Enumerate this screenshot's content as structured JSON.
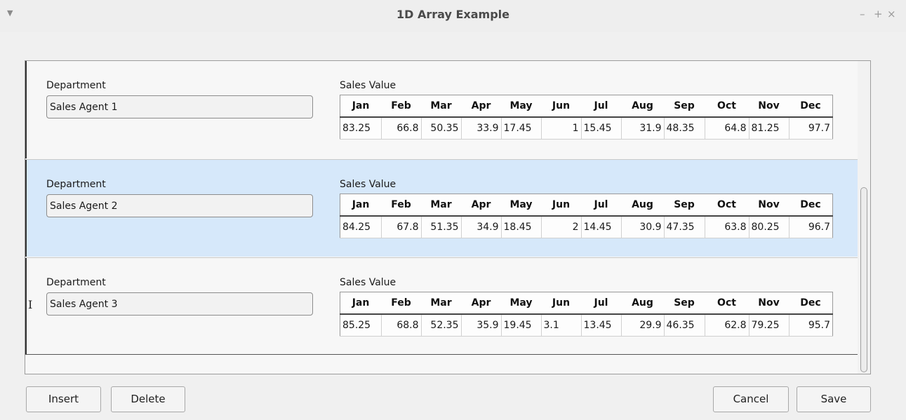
{
  "window": {
    "title": "1D Array Example",
    "menu_icon": "triangle-down-icon",
    "minimize_icon": "minimize-icon",
    "maximize_icon": "maximize-icon",
    "close_icon": "close-icon"
  },
  "list": {
    "selected_index": 1,
    "rows": [
      {
        "department_label": "Department",
        "department_value": "Sales Agent 1",
        "sales_label": "Sales Value",
        "months": [
          "Jan",
          "Feb",
          "Mar",
          "Apr",
          "May",
          "Jun",
          "Jul",
          "Aug",
          "Sep",
          "Oct",
          "Nov",
          "Dec"
        ],
        "values": [
          "83.25",
          "66.8",
          "50.35",
          "33.9",
          "17.45",
          "1",
          "15.45",
          "31.9",
          "48.35",
          "64.8",
          "81.25",
          "97.7"
        ]
      },
      {
        "department_label": "Department",
        "department_value": "Sales Agent 2",
        "sales_label": "Sales Value",
        "months": [
          "Jan",
          "Feb",
          "Mar",
          "Apr",
          "May",
          "Jun",
          "Jul",
          "Aug",
          "Sep",
          "Oct",
          "Nov",
          "Dec"
        ],
        "values": [
          "84.25",
          "67.8",
          "51.35",
          "34.9",
          "18.45",
          "2",
          "14.45",
          "30.9",
          "47.35",
          "63.8",
          "80.25",
          "96.7"
        ]
      },
      {
        "department_label": "Department",
        "department_value": "Sales Agent 3",
        "sales_label": "Sales Value",
        "months": [
          "Jan",
          "Feb",
          "Mar",
          "Apr",
          "May",
          "Jun",
          "Jul",
          "Aug",
          "Sep",
          "Oct",
          "Nov",
          "Dec"
        ],
        "values": [
          "85.25",
          "68.8",
          "52.35",
          "35.9",
          "19.45",
          "3.1",
          "13.45",
          "29.9",
          "46.35",
          "62.8",
          "79.25",
          "95.7"
        ]
      }
    ]
  },
  "buttons": {
    "insert": "Insert",
    "delete": "Delete",
    "cancel": "Cancel",
    "save": "Save"
  },
  "colors": {
    "selected_row": "#d6e8fa",
    "background": "#f0f0f0"
  }
}
